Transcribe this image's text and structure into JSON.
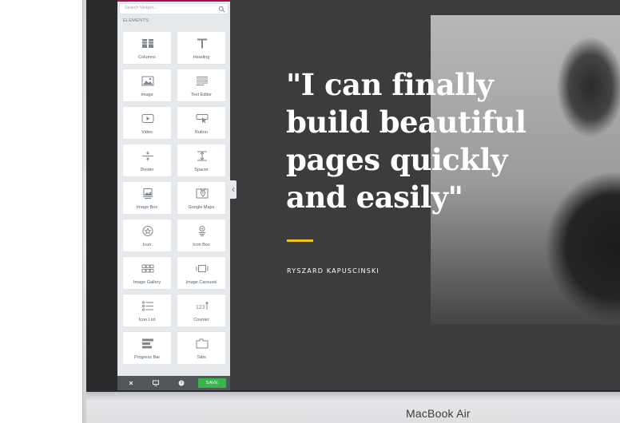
{
  "brand": {
    "device_name": "MacBook Air"
  },
  "editor": {
    "search_placeholder": "Search Widget...",
    "section_title": "ELEMENTS",
    "widgets": [
      {
        "label": "Columns",
        "icon": "columns-icon"
      },
      {
        "label": "Heading",
        "icon": "heading-icon"
      },
      {
        "label": "Image",
        "icon": "image-icon"
      },
      {
        "label": "Text Editor",
        "icon": "text-editor-icon"
      },
      {
        "label": "Video",
        "icon": "video-icon"
      },
      {
        "label": "Button",
        "icon": "button-icon"
      },
      {
        "label": "Divider",
        "icon": "divider-icon"
      },
      {
        "label": "Spacer",
        "icon": "spacer-icon"
      },
      {
        "label": "Image Box",
        "icon": "image-box-icon"
      },
      {
        "label": "Google Maps",
        "icon": "google-maps-icon"
      },
      {
        "label": "Icon",
        "icon": "star-icon"
      },
      {
        "label": "Icon Box",
        "icon": "icon-box-icon"
      },
      {
        "label": "Image Gallery",
        "icon": "image-gallery-icon"
      },
      {
        "label": "Image Carousel",
        "icon": "image-carousel-icon"
      },
      {
        "label": "Icon List",
        "icon": "icon-list-icon"
      },
      {
        "label": "Counter",
        "icon": "counter-icon"
      },
      {
        "label": "Progress Bar",
        "icon": "progress-bar-icon"
      },
      {
        "label": "Tabs",
        "icon": "tabs-icon"
      }
    ],
    "footer": {
      "save_label": "SAVE"
    },
    "colors": {
      "accent": "#a4124e",
      "save": "#39b54a"
    }
  },
  "preview": {
    "quote": "\"I can finally build beautiful pages quickly and easily\"",
    "author": "RYSZARD KAPUSCINSKI",
    "colors": {
      "background": "#3c3c3e",
      "accent_line": "#f0c419"
    }
  }
}
